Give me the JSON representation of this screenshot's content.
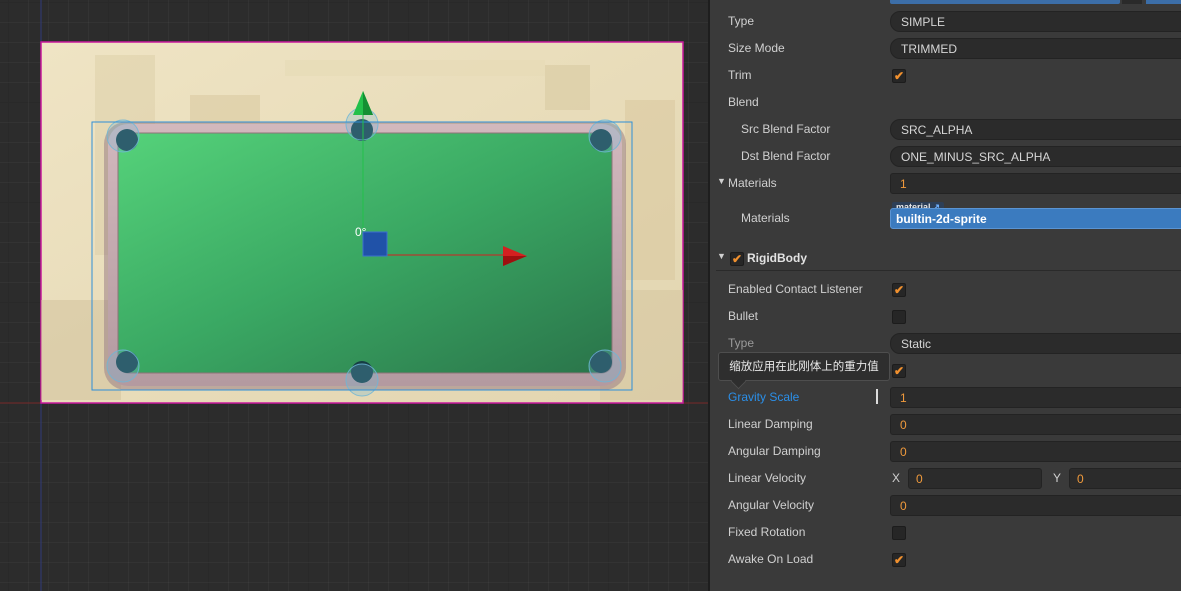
{
  "scene": {
    "rotation_label": "0°",
    "gizmo_colors": {
      "x_axis": "#d42020",
      "y_axis": "#22c04a",
      "center": "#2052a8"
    },
    "table_felt": "#3a9a5e",
    "frame_color": "#c8189c"
  },
  "inspector": {
    "sprite": {
      "type_label": "Type",
      "type_value": "SIMPLE",
      "size_mode_label": "Size Mode",
      "size_mode_value": "TRIMMED",
      "trim_label": "Trim",
      "trim_checked": "✔",
      "blend_label": "Blend",
      "src_blend_label": "Src Blend Factor",
      "src_blend_value": "SRC_ALPHA",
      "dst_blend_label": "Dst Blend Factor",
      "dst_blend_value": "ONE_MINUS_SRC_ALPHA"
    },
    "materials": {
      "toggle": "▼",
      "label": "Materials",
      "count": "1",
      "item_label": "Materials",
      "tag": "material",
      "tag_icon": "↗",
      "value": "builtin-2d-sprite"
    },
    "rigidbody": {
      "toggle": "▼",
      "enabled_check": "✔",
      "title": "RigidBody",
      "enabled_contact_label": "Enabled Contact Listener",
      "enabled_contact_check": "✔",
      "bullet_label": "Bullet",
      "type_label": "Type",
      "type_value": "Static",
      "allow_sleep_check": "✔",
      "gravity_scale_label": "Gravity Scale",
      "gravity_scale_value": "1",
      "linear_damping_label": "Linear Damping",
      "linear_damping_value": "0",
      "angular_damping_label": "Angular Damping",
      "angular_damping_value": "0",
      "linear_velocity_label": "Linear Velocity",
      "lv_x_label": "X",
      "lv_x_value": "0",
      "lv_y_label": "Y",
      "lv_y_value": "0",
      "angular_velocity_label": "Angular Velocity",
      "angular_velocity_value": "0",
      "fixed_rotation_label": "Fixed Rotation",
      "awake_on_load_label": "Awake On Load",
      "awake_on_load_check": "✔"
    },
    "tooltip": "缩放应用在此刚体上的重力值"
  }
}
